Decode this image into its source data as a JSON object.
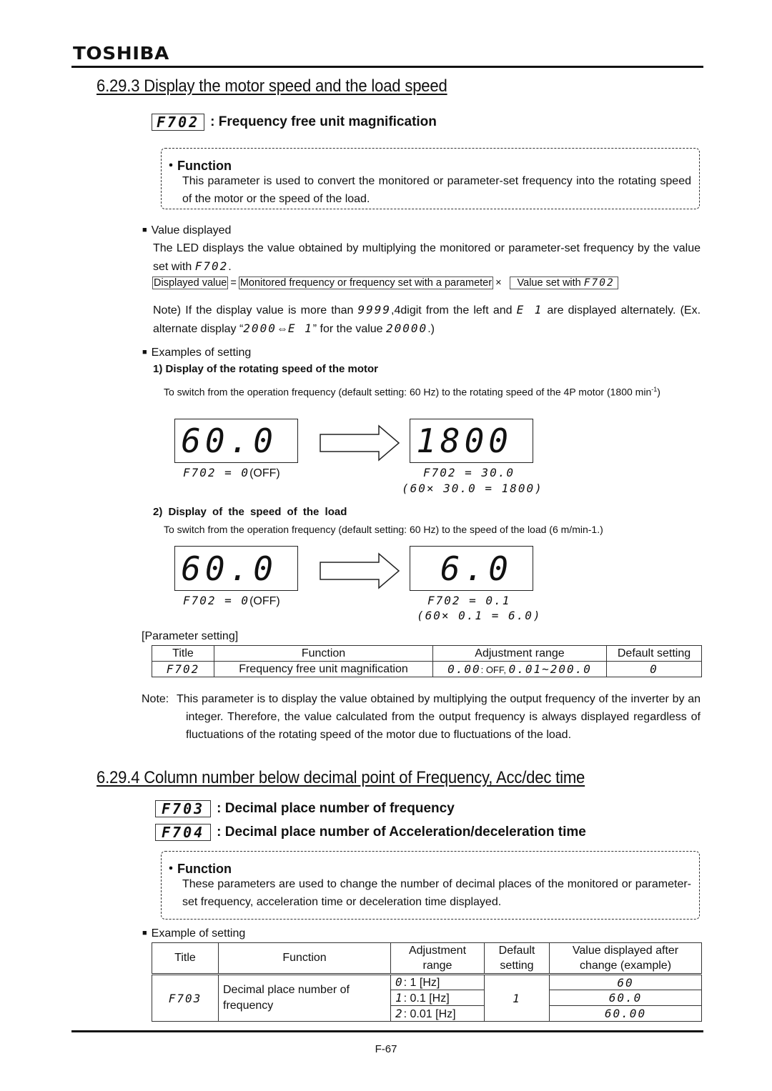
{
  "header": {
    "brand": "TOSHIBA"
  },
  "section1": {
    "title": "6.29.3 Display the motor speed and the load speed",
    "param": {
      "code": "F702",
      "label": ": Frequency free unit magnification"
    },
    "function_box": {
      "heading": "・Function",
      "text": "This parameter is used to convert the monitored or parameter-set frequency into the rotating speed of the motor or the speed of the load."
    },
    "value_displayed": {
      "heading": "Value displayed",
      "text_before": "The LED displays the value obtained by multiplying the monitored or parameter-set frequency by the value set with ",
      "text_code": "F702",
      "text_after": ".",
      "formula": {
        "left": "Displayed value",
        "eq": "=",
        "middle": "Monitored frequency or frequency set with a parameter",
        "times": "×",
        "right_label": "Value set with ",
        "right_code": "F702"
      },
      "note": {
        "p1": "Note) If the display value is more than ",
        "c1": "9999",
        "p2": ",4digit from the left and ",
        "c2": "E 1",
        "p3": " are displayed alternately. (Ex. alternate display “",
        "c3": "2000",
        "arrow": "⇔",
        "c4": "E 1",
        "p4": "” for the value ",
        "c5": "20000",
        "p5": ".)"
      }
    },
    "examples": {
      "heading": "Examples of setting",
      "ex1": {
        "title": "1) Display of the rotating speed of the motor",
        "desc": "To switch from the operation frequency (default setting: 60 Hz) to the rotating speed of the 4P motor (1800 min",
        "desc_sup": "-1",
        "desc_end": ")",
        "before_display": "60.0",
        "after_display": "1800",
        "before_caption_code": "F702 = 0",
        "before_caption_text": "(OFF)",
        "after_caption": "F702 = 30.0",
        "after_calc": "(60× 30.0 = 1800)"
      },
      "ex2": {
        "title": "2) Display of the speed of the load",
        "desc": "To switch from the operation frequency (default setting: 60 Hz) to the speed of the load (6 m/min-1.)",
        "before_display": "60.0",
        "after_display": "6.0",
        "before_caption_code": "F702 = 0",
        "before_caption_text": "(OFF)",
        "after_caption": "F702 = 0.1",
        "after_calc": "(60× 0.1 = 6.0)"
      }
    },
    "param_table": {
      "caption": "[Parameter setting]",
      "headers": [
        "Title",
        "Function",
        "Adjustment range",
        "Default setting"
      ],
      "row": {
        "title": "F702",
        "function": "Frequency free unit magnification",
        "range_code1": "0.00",
        "range_text": ": OFF, ",
        "range_code2": "0.01~200.0",
        "default": "0"
      }
    },
    "note": {
      "label": "Note:",
      "text": "This parameter is to display the value obtained by multiplying the output frequency of the inverter by an integer. Therefore, the value calculated from the output frequency is always displayed regardless of fluctuations of the rotating speed of the motor due to fluctuations of the load."
    }
  },
  "section2": {
    "title": "6.29.4 Column number below decimal point of Frequency, Acc/dec time",
    "params": [
      {
        "code": "F703",
        "label": ": Decimal place number of frequency"
      },
      {
        "code": "F704",
        "label": ": Decimal place number of Acceleration/deceleration time"
      }
    ],
    "function_box": {
      "heading": "・Function",
      "text": "These parameters are used to change the number of decimal places of the monitored or parameter-set frequency, acceleration time or deceleration time displayed."
    },
    "example": {
      "heading": "Example of setting",
      "headers": [
        "Title",
        "Function",
        "Adjustment range",
        "Default setting",
        "Value displayed after change (example)"
      ],
      "title": "F703",
      "function": "Decimal place number of frequency",
      "default": "1",
      "rows": [
        {
          "code": "0",
          "range": ": 1 [Hz]",
          "display": "60"
        },
        {
          "code": "1",
          "range": ": 0.1 [Hz]",
          "display": "60.0"
        },
        {
          "code": "2",
          "range": ": 0.01 [Hz]",
          "display": "60.00"
        }
      ]
    }
  },
  "footer": {
    "page": "F-67"
  }
}
